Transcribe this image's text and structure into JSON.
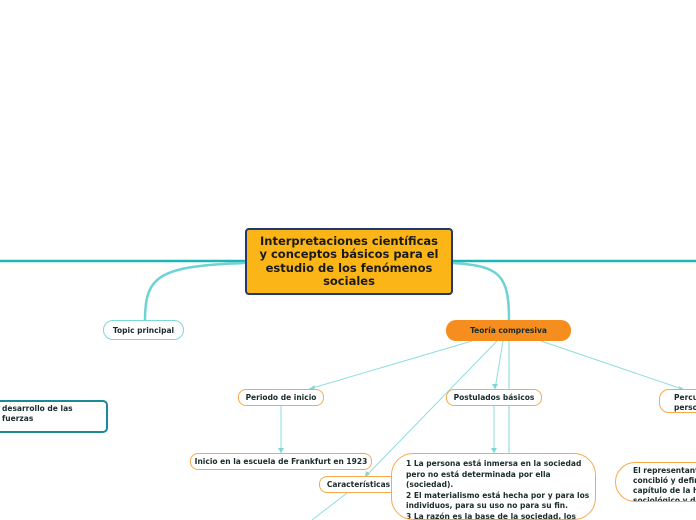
{
  "map": {
    "central_topic": "Interpretaciones científicas y conceptos básicos para el estudio de los fenómenos sociales",
    "colors": {
      "central_fill": "#fbb516",
      "central_border": "#1f3a73",
      "main_branch_line": "#1fb5b5",
      "sub_branch_line": "#7fd6d6",
      "orange_accent": "#f68d1f",
      "orange_border": "#f7a94a",
      "teal_border": "#1a8a96"
    },
    "nodes": {
      "topic_principal": "Topic principal",
      "teoria_compresiva": "Teoría compresiva",
      "periodo_inicio": "Periodo de inicio",
      "postulados_basicos": "Postulados básicos",
      "percu_partial": "Percu\nperso",
      "inicio_frankfurt": "Inicio en la escuela de Frankfurt en 1923",
      "caracteristicas": "Características",
      "postulados_text": "1 La persona está inmersa en la sociedad\npero no está determinada por ella\n(sociedad).\n2 El materialismo está hecha por y para los\nindividuos, para su uso no para su fin.\n3 La razón es la base de la sociedad, los\nindividuos son pensantes.",
      "representante_partial": "El representante\nconcibió y defini\ncapítulo de la hi\nsociológico y de",
      "left_box_partial": "desarrollo de las fuerzas\n\nabajar"
    }
  }
}
